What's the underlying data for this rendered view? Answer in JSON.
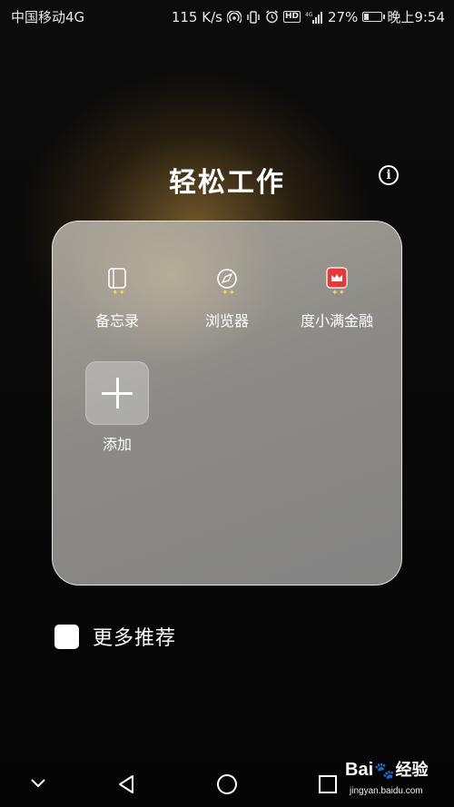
{
  "status_bar": {
    "carrier": "中国移动4G",
    "speed": "115 K/s",
    "network_label": "4G",
    "battery_percent": "27%",
    "battery_level": 0.27,
    "time": "晚上9:54"
  },
  "header": {
    "title": "轻松工作",
    "info_symbol": "i"
  },
  "apps": [
    {
      "label": "备忘录",
      "icon": "notepad-icon"
    },
    {
      "label": "浏览器",
      "icon": "browser-icon"
    },
    {
      "label": "度小满金融",
      "icon": "duxiaoman-icon"
    }
  ],
  "add_tile": {
    "label": "添加"
  },
  "more": {
    "label": "更多推荐"
  },
  "watermark": {
    "main": "Bai",
    "paw": "🐾",
    "sub": "经验",
    "url": "jingyan.baidu.com"
  },
  "colors": {
    "accent_red": "#e53935",
    "card_gray": "#8d8b87",
    "sparkle": "#f4d35e"
  }
}
